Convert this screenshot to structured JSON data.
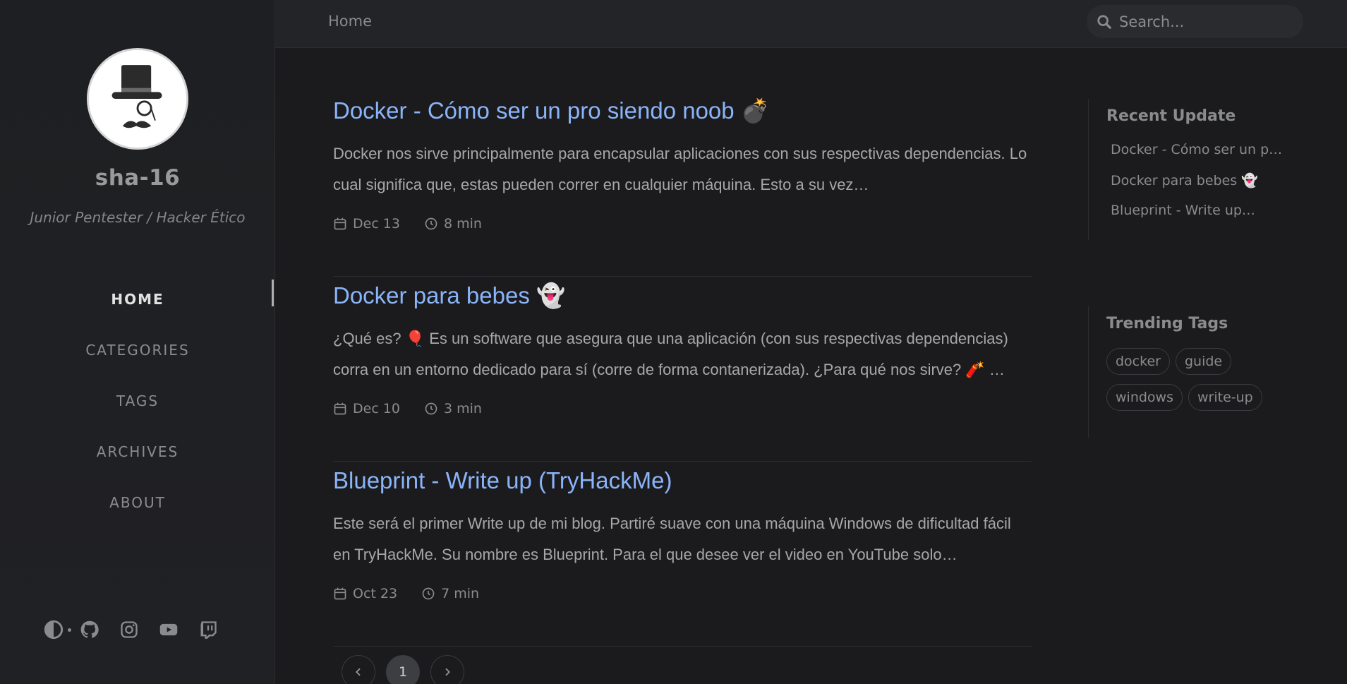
{
  "sidebar": {
    "site_title": "sha-16",
    "site_subtitle": "Junior Pentester / Hacker Ético",
    "nav": [
      {
        "label": "HOME"
      },
      {
        "label": "CATEGORIES"
      },
      {
        "label": "TAGS"
      },
      {
        "label": "ARCHIVES"
      },
      {
        "label": "ABOUT"
      }
    ],
    "active_nav": "HOME",
    "bottom_icons": [
      "theme-toggle-icon",
      "github-icon",
      "instagram-icon",
      "youtube-icon",
      "twitch-icon"
    ]
  },
  "topbar": {
    "breadcrumb": "Home",
    "search_placeholder": "Search..."
  },
  "posts": [
    {
      "title": "Docker - Cómo ser un pro siendo noob 💣",
      "excerpt": "Docker nos sirve principalmente para encapsular aplicaciones con sus respectivas dependencias. Lo cual significa que, estas pueden correr en cualquier máquina. Esto a su vez…",
      "date": "Dec 13",
      "read_time": "8 min"
    },
    {
      "title": "Docker para bebes 👻",
      "excerpt": "¿Qué es? 🎈 Es un software que asegura que una aplicación (con sus respectivas dependencias) corra en un entorno dedicado para sí (corre de forma contanerizada). ¿Para qué nos sirve? 🧨 …",
      "date": "Dec 10",
      "read_time": "3 min"
    },
    {
      "title": "Blueprint - Write up (TryHackMe)",
      "excerpt": "Este será el primer Write up de mi blog. Partiré suave con una máquina Windows de dificultad fácil en TryHackMe. Su nombre es Blueprint. Para el que desee ver el video en YouTube solo…",
      "date": "Oct 23",
      "read_time": "7 min"
    }
  ],
  "pagination": {
    "current_page": "1"
  },
  "recent_update": {
    "heading": "Recent Update",
    "items": [
      "Docker - Cómo ser un pro…",
      "Docker para bebes 👻",
      "Blueprint - Write up…"
    ]
  },
  "trending_tags": {
    "heading": "Trending Tags",
    "tags": [
      "docker",
      "guide",
      "windows",
      "write-up"
    ]
  },
  "colors": {
    "background": "#1b1b1e",
    "sidebar": "#1e1f22",
    "link": "#8ab4f8",
    "text": "#a6a7a8",
    "muted": "#8a8b8c"
  }
}
